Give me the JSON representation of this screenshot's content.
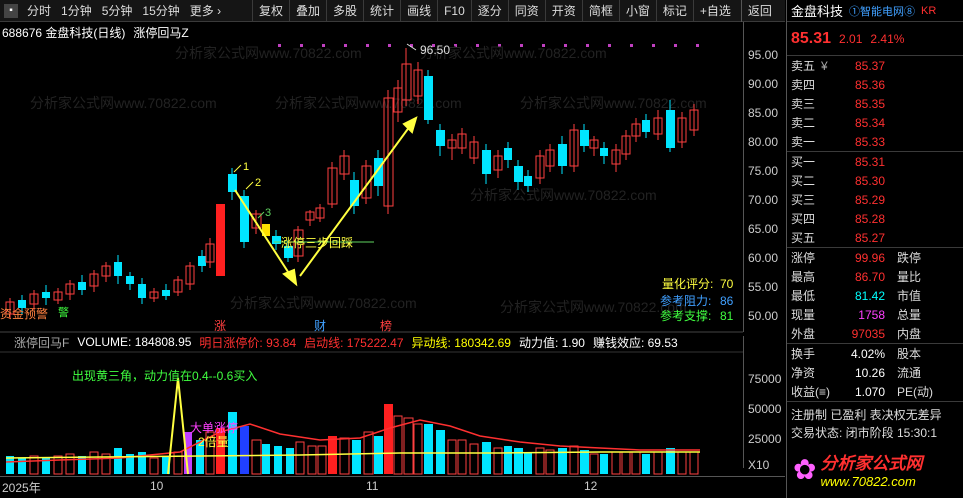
{
  "toolbar": {
    "left_items": [
      "分时",
      "1分钟",
      "5分钟",
      "15分钟",
      "更多 ›"
    ],
    "buttons": [
      "复权",
      "叠加",
      "多股",
      "统计",
      "画线",
      "F10",
      "逐分",
      "同资",
      "开资",
      "简框",
      "小窗",
      "标记",
      "+自选",
      "返回"
    ]
  },
  "chart": {
    "code_title": "688676 金盘科技(日线)",
    "indicator_title": "涨停回马Z",
    "watermark": "分析家公式网www.70822.com",
    "price_axis": [
      "95.00",
      "90.00",
      "85.00",
      "80.00",
      "75.00",
      "70.00",
      "65.00",
      "60.00",
      "55.00",
      "50.00"
    ],
    "peak_label": "96.50",
    "markers": [
      "1",
      "2",
      "3"
    ],
    "annotation_middle": "涨停三步回踩",
    "left_label": "资金预警",
    "left_label2": "警",
    "events": [
      "涨",
      "财",
      "榜"
    ],
    "score": {
      "label1": "量化评分:",
      "val1": "70",
      "label2": "参考阻力:",
      "val2": "86",
      "label3": "参考支撑:",
      "val3": "81"
    },
    "date_labels": [
      "2025年",
      "10",
      "11",
      "12"
    ]
  },
  "indicator": {
    "name": "涨停回马F",
    "volume_label": "VOLUME: 184808.95",
    "tomorrow": "明日涨停价: 93.84",
    "start_line": "启动线: 175222.47",
    "abnormal_line": "异动线: 180342.69",
    "power": "动力值: 1.90",
    "profit": "赚钱效应: 69.53",
    "note": "出现黄三角，动力值在0.4--0.6买入",
    "big_order": "大单涨停",
    "double_vol": "2倍量",
    "vol_axis": [
      "75000",
      "50000",
      "25000"
    ],
    "x10": "X10"
  },
  "quote": {
    "name": "金盘科技",
    "tag": "①智能电网⑧",
    "suffix": "KR",
    "price": "85.31",
    "change": "2.01",
    "pct": "2.41%",
    "sell": [
      {
        "k": "卖五",
        "unit": "¥",
        "v": "85.37"
      },
      {
        "k": "卖四",
        "unit": "",
        "v": "85.36"
      },
      {
        "k": "卖三",
        "unit": "",
        "v": "85.35"
      },
      {
        "k": "卖二",
        "unit": "",
        "v": "85.34"
      },
      {
        "k": "卖一",
        "unit": "",
        "v": "85.33"
      }
    ],
    "buy": [
      {
        "k": "买一",
        "v": "85.31"
      },
      {
        "k": "买二",
        "v": "85.30"
      },
      {
        "k": "买三",
        "v": "85.29"
      },
      {
        "k": "买四",
        "v": "85.28"
      },
      {
        "k": "买五",
        "v": "85.27"
      }
    ],
    "stats": [
      {
        "k": "涨停",
        "v": "99.96",
        "k2": "跌停"
      },
      {
        "k": "最高",
        "v": "86.70",
        "k2": "量比"
      },
      {
        "k": "最低",
        "v": "81.42",
        "k2": "市值"
      },
      {
        "k": "现量",
        "v": "1758",
        "k2": "总量"
      },
      {
        "k": "外盘",
        "v": "97035",
        "k2": "内盘"
      }
    ],
    "stats2": [
      {
        "k": "换手",
        "v": "4.02%",
        "k2": "股本"
      },
      {
        "k": "净资",
        "v": "10.26",
        "k2": "流通"
      },
      {
        "k": "收益(≡)",
        "v": "1.070",
        "k2": "PE(动)"
      }
    ],
    "reg": "注册制 已盈利 表决权无差异",
    "status": "交易状态: 闭市阶段 15:30:1"
  },
  "logo": {
    "text": "分析家公式网",
    "url": "www.70822.com"
  }
}
